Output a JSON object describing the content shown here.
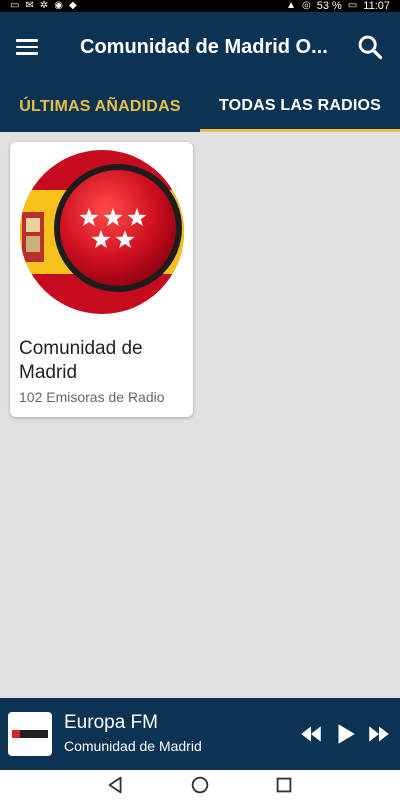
{
  "status_bar": {
    "battery_text": "53 %",
    "time": "11:07"
  },
  "app": {
    "title": "Comunidad de Madrid O..."
  },
  "tabs": [
    {
      "label": "ÚLTIMAS AÑADIDAS",
      "selected": false
    },
    {
      "label": "TODAS LAS RADIOS",
      "selected": true
    }
  ],
  "cards": [
    {
      "title": "Comunidad de Madrid",
      "subtitle": "102 Emisoras de Radio",
      "logo_icon": "madrid-flag-icon"
    }
  ],
  "player": {
    "station": "Europa FM",
    "region": "Comunidad de Madrid",
    "thumb_icon": "europa-fm-logo-icon"
  },
  "colors": {
    "appbar_bg": "#0d3354",
    "accent": "#e6c14a",
    "content_bg": "#e0e0e0"
  }
}
